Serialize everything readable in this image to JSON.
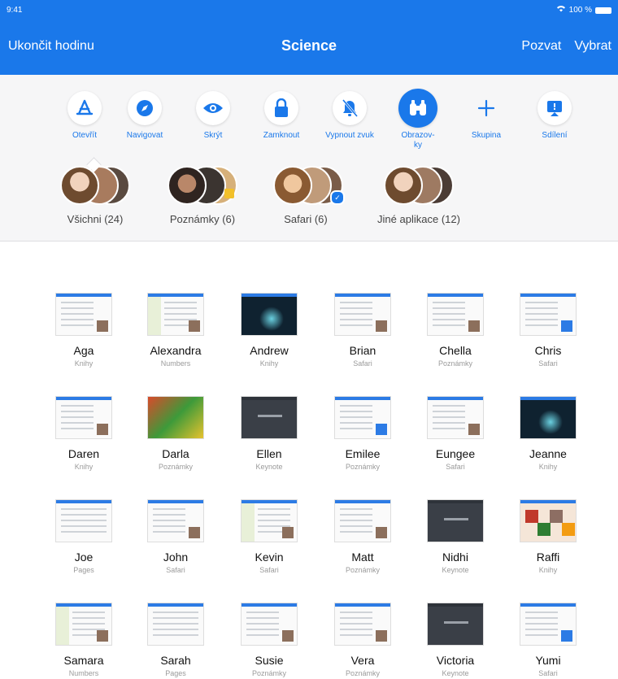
{
  "status": {
    "time": "9:41",
    "battery": "100 %"
  },
  "nav": {
    "left": "Ukončit hodinu",
    "title": "Science",
    "invite": "Pozvat",
    "select": "Vybrat"
  },
  "actions": [
    {
      "label": "Otevřít",
      "icon": "app-store-icon"
    },
    {
      "label": "Navigovat",
      "icon": "compass-icon"
    },
    {
      "label": "Skrýt",
      "icon": "eye-icon"
    },
    {
      "label": "Zamknout",
      "icon": "lock-icon"
    },
    {
      "label": "Vypnout zvuk",
      "icon": "bell-slash-icon"
    },
    {
      "label": "Obrazov-ky",
      "icon": "binoculars-icon"
    },
    {
      "label": "Skupina",
      "icon": "plus-icon"
    },
    {
      "label": "Sdílení",
      "icon": "airplay-icon"
    }
  ],
  "groups": [
    {
      "label": "Všichni (24)"
    },
    {
      "label": "Poznámky (6)"
    },
    {
      "label": "Safari (6)"
    },
    {
      "label": "Jiné aplikace (12)"
    }
  ],
  "students": [
    {
      "name": "Aga",
      "app": "Knihy"
    },
    {
      "name": "Alexandra",
      "app": "Numbers"
    },
    {
      "name": "Andrew",
      "app": "Knihy"
    },
    {
      "name": "Brian",
      "app": "Safari"
    },
    {
      "name": "Chella",
      "app": "Poznámky"
    },
    {
      "name": "Chris",
      "app": "Safari"
    },
    {
      "name": "Daren",
      "app": "Knihy"
    },
    {
      "name": "Darla",
      "app": "Poznámky"
    },
    {
      "name": "Ellen",
      "app": "Keynote"
    },
    {
      "name": "Emilee",
      "app": "Poznámky"
    },
    {
      "name": "Eungee",
      "app": "Safari"
    },
    {
      "name": "Jeanne",
      "app": "Knihy"
    },
    {
      "name": "Joe",
      "app": "Pages"
    },
    {
      "name": "John",
      "app": "Safari"
    },
    {
      "name": "Kevin",
      "app": "Safari"
    },
    {
      "name": "Matt",
      "app": "Poznámky"
    },
    {
      "name": "Nidhi",
      "app": "Keynote"
    },
    {
      "name": "Raffi",
      "app": "Knihy"
    },
    {
      "name": "Samara",
      "app": "Numbers"
    },
    {
      "name": "Sarah",
      "app": "Pages"
    },
    {
      "name": "Susie",
      "app": "Poznámky"
    },
    {
      "name": "Vera",
      "app": "Poznámky"
    },
    {
      "name": "Victoria",
      "app": "Keynote"
    },
    {
      "name": "Yumi",
      "app": "Safari"
    }
  ],
  "colors": {
    "accent": "#1a78ea"
  }
}
